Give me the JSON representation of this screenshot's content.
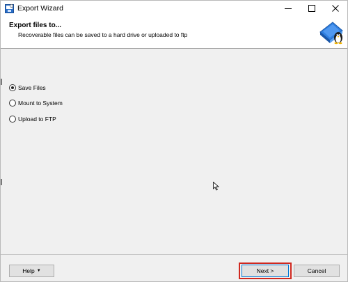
{
  "window": {
    "title": "Export Wizard"
  },
  "header": {
    "title": "Export files to...",
    "subtitle": "Recoverable files can be saved to a hard drive or uploaded to ftp"
  },
  "options": [
    {
      "label": "Save Files",
      "checked": true
    },
    {
      "label": "Mount to System",
      "checked": false
    },
    {
      "label": "Upload to FTP",
      "checked": false
    }
  ],
  "buttons": {
    "help": "Help",
    "next": "Next >",
    "cancel": "Cancel"
  },
  "colors": {
    "accent": "#0078d7",
    "highlight": "#d0281f"
  }
}
